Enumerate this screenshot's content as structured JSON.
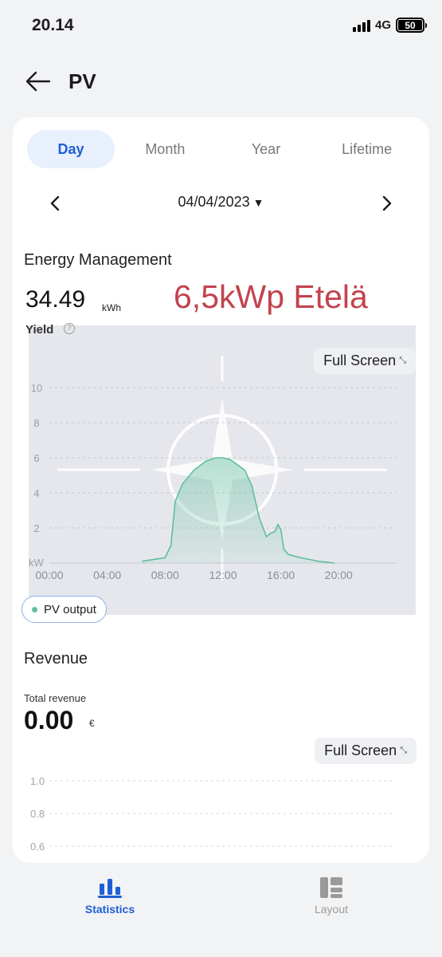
{
  "status_bar": {
    "time": "20.14",
    "network": "4G",
    "battery": "50"
  },
  "header": {
    "title": "PV"
  },
  "tabs": [
    {
      "label": "Day",
      "active": true
    },
    {
      "label": "Month",
      "active": false
    },
    {
      "label": "Year",
      "active": false
    },
    {
      "label": "Lifetime",
      "active": false
    }
  ],
  "date": {
    "value": "04/04/2023",
    "caret": "▼"
  },
  "energy": {
    "title": "Energy Management",
    "yield_value": "34.49",
    "yield_unit": "kWh",
    "overlay_text": "6,5kWp Etelä",
    "yield_label": "Yield",
    "help": "?",
    "full_screen": "Full Screen",
    "legend": "PV output",
    "chart_color": "#5fbf9b"
  },
  "chart_data": {
    "type": "area",
    "ylabel": "kW",
    "yticks": [
      2,
      4,
      6,
      8,
      10
    ],
    "ylim": [
      0,
      10
    ],
    "xticks": [
      "00:00",
      "04:00",
      "08:00",
      "12:00",
      "16:00",
      "20:00"
    ],
    "xlim": [
      0,
      24
    ],
    "grid": true,
    "series": [
      {
        "name": "PV output",
        "x": [
          6.4,
          7.2,
          8.0,
          8.4,
          8.7,
          9.2,
          10.0,
          10.8,
          11.5,
          12.0,
          12.5,
          13.0,
          13.5,
          14.0,
          14.5,
          15.0,
          15.3,
          15.6,
          15.8,
          16.0,
          16.2,
          16.5,
          16.9,
          17.4,
          18.0,
          18.6,
          19.2,
          19.7
        ],
        "y": [
          0.1,
          0.2,
          0.3,
          1.0,
          3.5,
          4.5,
          5.3,
          5.8,
          6.0,
          6.0,
          5.9,
          5.6,
          5.3,
          4.4,
          2.6,
          1.5,
          1.7,
          1.8,
          2.2,
          1.9,
          0.8,
          0.5,
          0.4,
          0.3,
          0.2,
          0.1,
          0.05,
          0.0
        ]
      }
    ]
  },
  "revenue": {
    "title": "Revenue",
    "total_label": "Total revenue",
    "total_value": "0.00",
    "currency": "€",
    "full_screen": "Full Screen",
    "chart_data": {
      "type": "line",
      "yticks": [
        "1.0",
        "0.8",
        "0.6"
      ]
    }
  },
  "nav": [
    {
      "label": "Statistics",
      "active": true,
      "icon": "bar-chart-icon"
    },
    {
      "label": "Layout",
      "active": false,
      "icon": "layout-icon"
    }
  ]
}
